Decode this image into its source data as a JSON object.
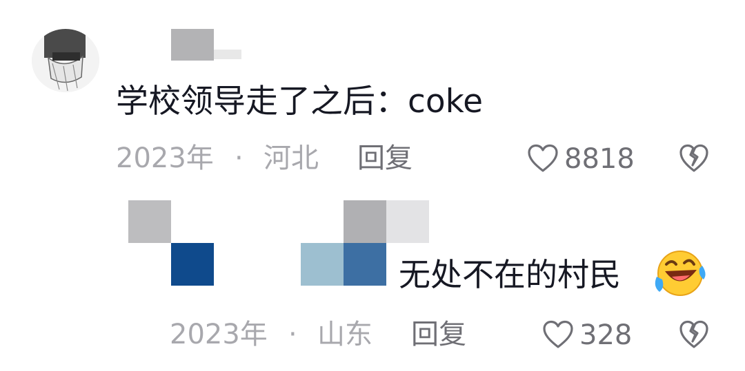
{
  "comments": [
    {
      "text": "学校领导走了之后：coke",
      "year": "2023年",
      "separator": "·",
      "location": "河北",
      "reply_label": "回复",
      "likes": "8818"
    },
    {
      "text": "无处不在的村民",
      "emoji": "🤣",
      "year": "2023年",
      "separator": "·",
      "location": "山东",
      "reply_label": "回复",
      "likes": "328"
    }
  ],
  "icons": {
    "like": "heart-outline-icon",
    "dislike": "broken-heart-icon"
  },
  "colors": {
    "text": "#161823",
    "meta": "#a8a8ad",
    "action": "#6f6f75",
    "blur_dark_blue": "#0f4a8c",
    "blur_light_blue": "#9dbfd0",
    "blur_mid_blue": "#3d6fa3",
    "blur_gray": "#b0b0b3"
  }
}
